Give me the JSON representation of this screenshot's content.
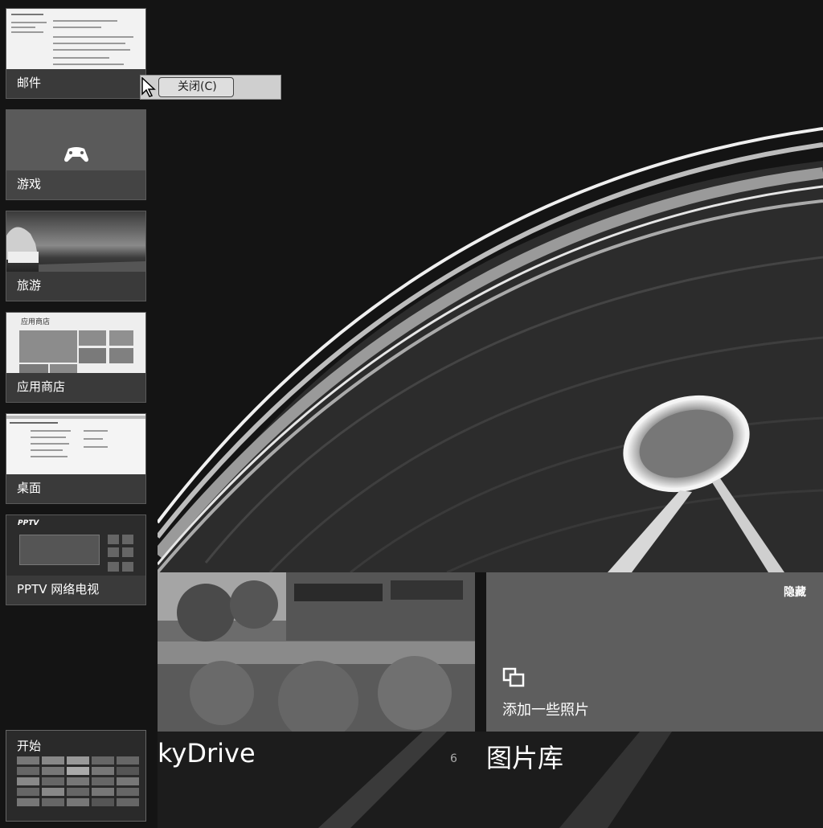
{
  "switcher": {
    "apps": [
      {
        "label": "邮件"
      },
      {
        "label": "游戏"
      },
      {
        "label": "旅游"
      },
      {
        "label": "应用商店"
      },
      {
        "label": "桌面"
      },
      {
        "label": "PPTV 网络电视"
      }
    ],
    "store_preview_title": "应用商店",
    "pptv_logo": "PPTV",
    "start": {
      "label": "开始"
    }
  },
  "context_menu": {
    "close_label": "关闭(C)"
  },
  "photos": {
    "hide_label": "隐藏",
    "add_photos_label": "添加一些照片",
    "skydrive_title": "kyDrive",
    "skydrive_count": "6",
    "library_title": "图片库"
  },
  "icons": {
    "games": "gamepad-icon",
    "add_photos": "add-photos-icon",
    "cursor": "mouse-cursor-icon"
  }
}
